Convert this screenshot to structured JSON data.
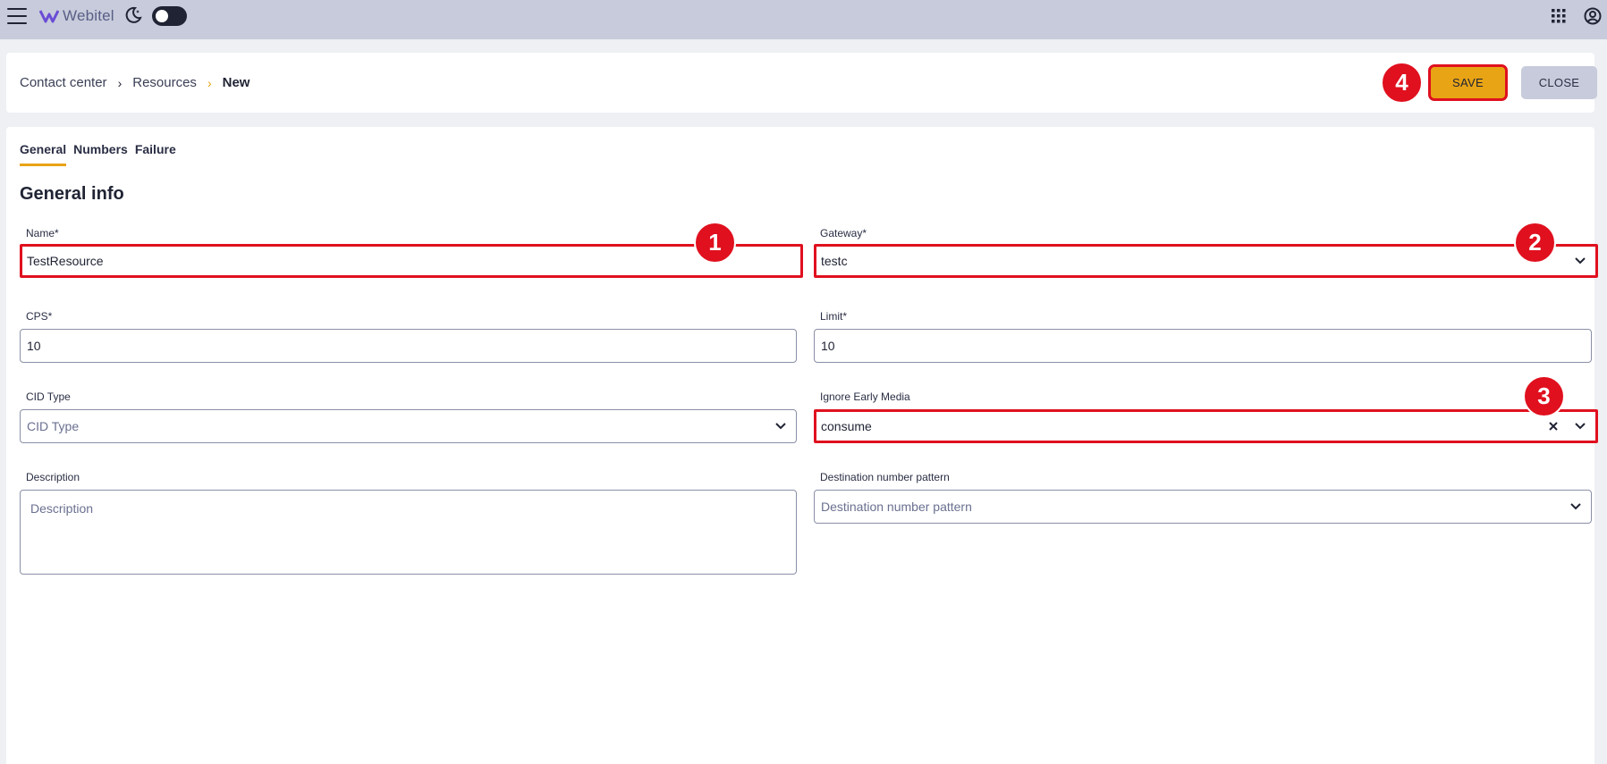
{
  "topbar": {
    "logo_text": "Webitel",
    "icons": [
      "menu-icon",
      "webitel-logo-icon",
      "moon-icon",
      "toggle",
      "apps-grid-icon",
      "account-icon"
    ],
    "theme_toggle_on": false
  },
  "breadcrumb": {
    "items": [
      "Contact center",
      "Resources",
      "New"
    ]
  },
  "header": {
    "save_label": "SAVE",
    "close_label": "CLOSE"
  },
  "tabs": [
    "General",
    "Numbers",
    "Failure"
  ],
  "section_title": "General info",
  "form": {
    "name": {
      "label": "Name*",
      "value": "TestResource"
    },
    "gateway": {
      "label": "Gateway*",
      "value": "testc"
    },
    "cps": {
      "label": "CPS*",
      "value": "10"
    },
    "limit": {
      "label": "Limit*",
      "value": "10"
    },
    "cid_type": {
      "label": "CID Type",
      "placeholder": "CID Type"
    },
    "ignore_early_media": {
      "label": "Ignore Early Media",
      "value": "consume"
    },
    "description": {
      "label": "Description",
      "placeholder": "Description"
    },
    "destination_pattern": {
      "label": "Destination number pattern",
      "placeholder": "Destination number pattern"
    }
  },
  "annotations": [
    "1",
    "2",
    "3",
    "4"
  ],
  "colors": {
    "accent": "#e8a415",
    "highlight": "#e0101e",
    "topbar": "#c7cbdb"
  }
}
